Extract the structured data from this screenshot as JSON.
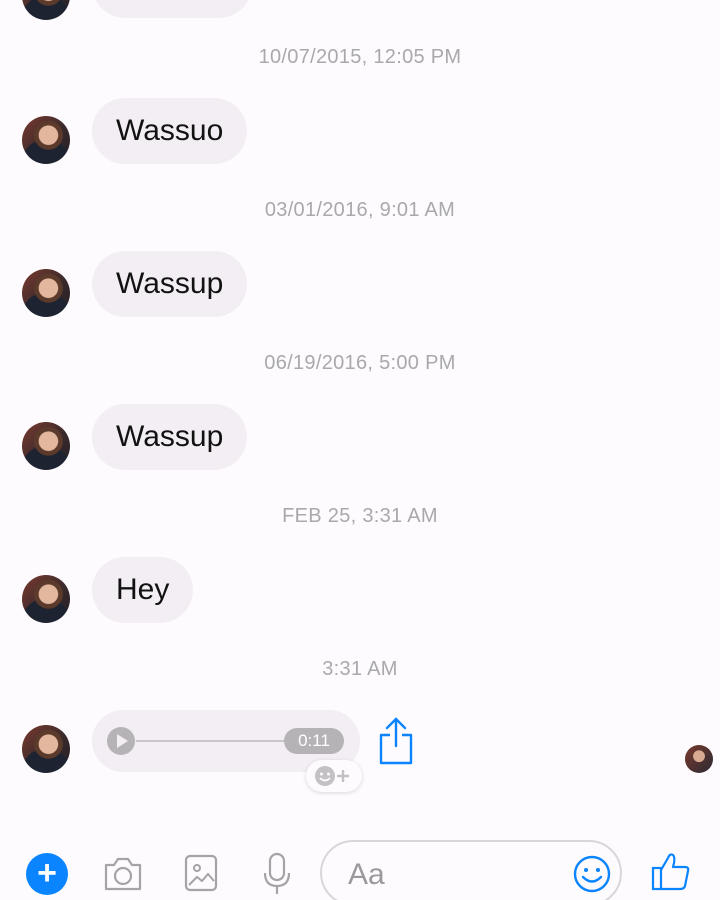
{
  "messages": [
    {
      "timestamp": "10/07/2015, 12:05 PM",
      "text": "Wassuo"
    },
    {
      "timestamp": "03/01/2016, 9:01 AM",
      "text": "Wassup"
    },
    {
      "timestamp": "06/19/2016, 5:00 PM",
      "text": "Wassup"
    },
    {
      "timestamp": "FEB 25, 3:31 AM",
      "text": "Hey"
    }
  ],
  "voice_message": {
    "timestamp": "3:31 AM",
    "duration": "0:11"
  },
  "composer": {
    "placeholder": "Aa"
  },
  "colors": {
    "accent": "#0a84ff",
    "bubble": "#f3eef3",
    "timestamp": "#a9a8ab"
  },
  "icons": [
    "plus-icon",
    "camera-icon",
    "gallery-icon",
    "microphone-icon",
    "emoji-icon",
    "thumbs-up-icon",
    "share-icon",
    "play-icon",
    "add-reaction-icon"
  ]
}
